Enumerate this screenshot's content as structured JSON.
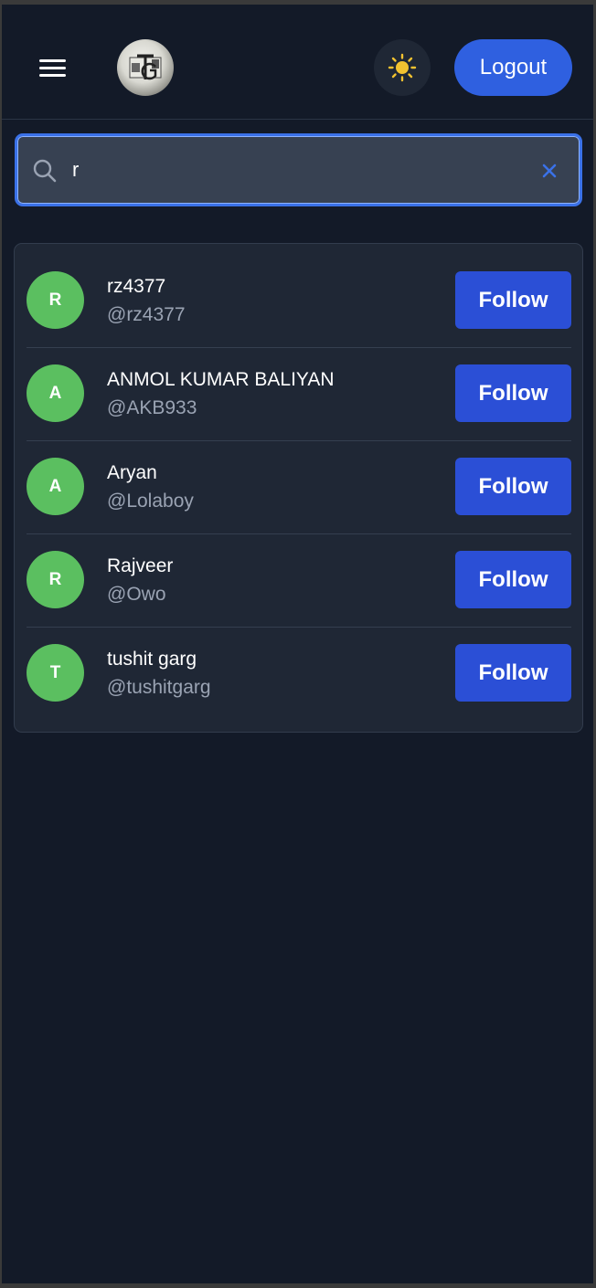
{
  "header": {
    "logout_label": "Logout"
  },
  "search": {
    "value": "r"
  },
  "results": [
    {
      "initial": "R",
      "name": "rz4377",
      "handle": "@rz4377",
      "follow_label": "Follow"
    },
    {
      "initial": "A",
      "name": "ANMOL KUMAR BALIYAN",
      "handle": "@AKB933",
      "follow_label": "Follow"
    },
    {
      "initial": "A",
      "name": "Aryan",
      "handle": "@Lolaboy",
      "follow_label": "Follow"
    },
    {
      "initial": "R",
      "name": "Rajveer",
      "handle": "@Owo",
      "follow_label": "Follow"
    },
    {
      "initial": "T",
      "name": "tushit garg",
      "handle": "@tushitgarg",
      "follow_label": "Follow"
    }
  ],
  "icons": {
    "menu": "hamburger-menu-icon",
    "theme": "sun-icon",
    "search": "search-icon",
    "clear": "close-icon"
  },
  "colors": {
    "background": "#131a28",
    "card": "#1f2735",
    "accent": "#2f60e0",
    "follow": "#2b4fd6",
    "avatar": "#5bbf60",
    "sun": "#f2c230"
  }
}
